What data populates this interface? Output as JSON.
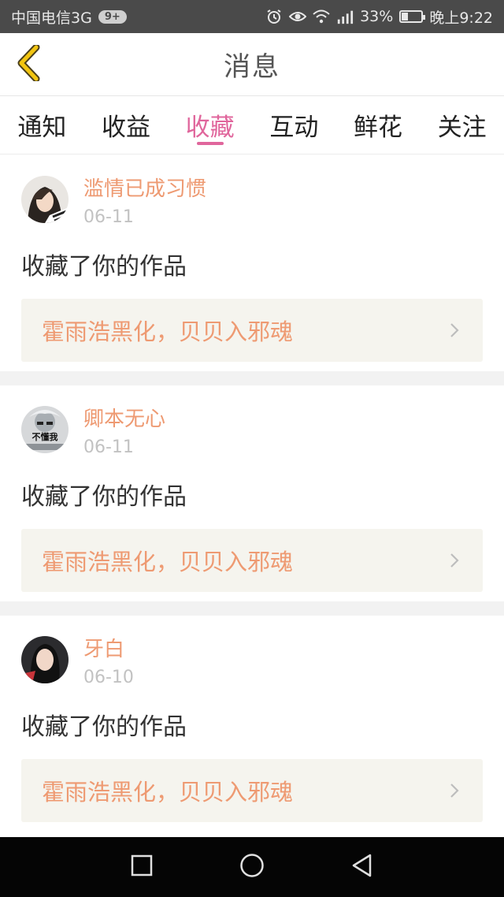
{
  "status_bar": {
    "carrier": "中国电信3G",
    "notification_badge": "9+",
    "battery_percent": "33%",
    "battery_level": 0.33,
    "time": "晚上9:22",
    "icons": [
      "alarm-icon",
      "eye-icon",
      "wifi-icon",
      "signal-icon",
      "battery-icon"
    ]
  },
  "header": {
    "title": "消息",
    "back_icon": "chevron-left-icon"
  },
  "tabs": [
    {
      "label": "通知",
      "active": false
    },
    {
      "label": "收益",
      "active": false
    },
    {
      "label": "收藏",
      "active": true
    },
    {
      "label": "互动",
      "active": false
    },
    {
      "label": "鲜花",
      "active": false
    },
    {
      "label": "关注",
      "active": false
    }
  ],
  "feed": [
    {
      "username": "滥情已成习惯",
      "date": "06-11",
      "action": "收藏了你的作品",
      "work_title": "霍雨浩黑化，贝贝入邪魂"
    },
    {
      "username": "卿本无心",
      "date": "06-11",
      "action": "收藏了你的作品",
      "work_title": "霍雨浩黑化，贝贝入邪魂",
      "avatar_text": "不懂我"
    },
    {
      "username": "牙白",
      "date": "06-10",
      "action": "收藏了你的作品",
      "work_title": "霍雨浩黑化，贝贝入邪魂"
    }
  ],
  "colors": {
    "accent_pink": "#e0669c",
    "orange_text": "#ee9a72",
    "status_bar_bg": "#4a4a4a",
    "nav_bar_bg": "#050505"
  },
  "nav_bar": {
    "icons": [
      "recent-apps-icon",
      "home-icon",
      "back-icon"
    ]
  }
}
